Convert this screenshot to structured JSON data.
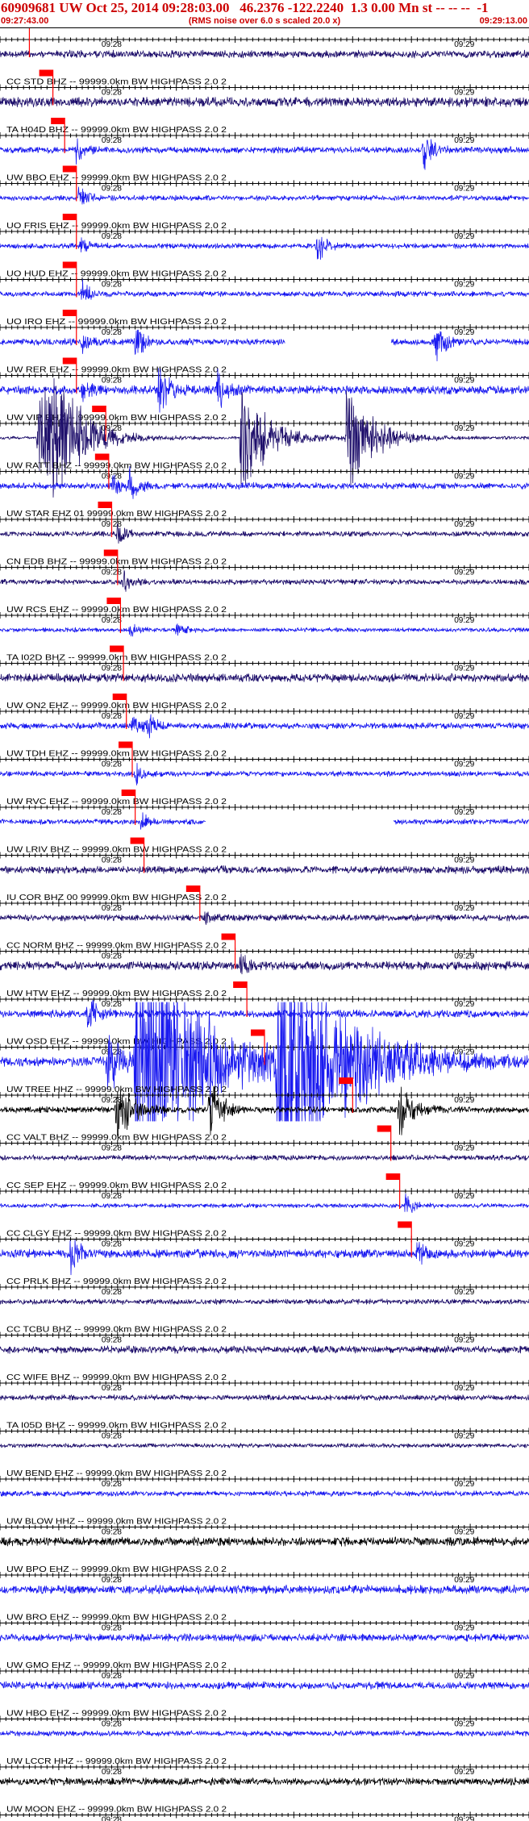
{
  "header": {
    "title": "60909681 UW Oct 25, 2014 09:28:03.00   46.2376 -122.2240  1.3 0.00 Mn st -- -- --  -1",
    "start_time": "09:27:43.00",
    "end_time": "09:29:13.00",
    "note": "(RMS noise over 6.0 s scaled 20.0 x)"
  },
  "chart_data": {
    "type": "line",
    "title": "60909681 UW Oct 25, 2014 09:28:03.00   46.2376 -122.2240  1.3 0.00 Mn st -- -- --  -1",
    "xlabel": "",
    "ylabel": "",
    "time_ticks": [
      "09:28",
      "09:29"
    ],
    "time_tick_seconds": [
      17,
      77
    ],
    "window_seconds": [
      0,
      90
    ],
    "grid": false,
    "colors": {
      "blue": "#1a1af0",
      "navy": "#1e0f6b",
      "black": "#000000",
      "pick": "#ff0000",
      "text": "#000000"
    },
    "bursts": {
      "brief": [
        [
          2,
          24.8
        ],
        [
          2,
          24.8
        ],
        [
          2,
          24.8
        ],
        [
          1.8,
          52.5
        ]
      ],
      "big": [
        [
          1.4,
          18.2
        ],
        [
          6,
          23
        ],
        [
          6,
          47.2
        ]
      ],
      "long": [
        [
          1.4,
          19.8
        ],
        [
          1.2,
          35.6
        ],
        [
          1.2,
          67.9
        ]
      ],
      "busy": [
        [
          2.5,
          6.5
        ],
        [
          2.5,
          9
        ],
        [
          2.5,
          41
        ],
        [
          2.5,
          59
        ]
      ]
    },
    "traces": [
      {
        "label": "",
        "color": "navy",
        "noise": 0.14,
        "pick": 5.0,
        "bursts": []
      },
      {
        "label": "CC STD BHZ -- 99999.0km BW  HIGHPASS  2.0  2",
        "color": "navy",
        "noise": 0.18,
        "pick": 9.0,
        "bursts": []
      },
      {
        "label": "TA H04D BHZ -- 99999.0km BW  HIGHPASS  2.0  2",
        "color": "blue",
        "noise": 0.12,
        "pick": 11.0,
        "bursts": [
          [
            0.5,
            13
          ],
          [
            0.8,
            72
          ]
        ]
      },
      {
        "label": "UW BBO EHZ -- 99999.0km BW  HIGHPASS  2.0  2",
        "color": "blue",
        "noise": 0.1,
        "pick": 13.0,
        "bursts": [
          [
            0.6,
            13.5
          ]
        ]
      },
      {
        "label": "UO FRIS EHZ -- 99999.0km BW  HIGHPASS  2.0  2",
        "color": "blue",
        "noise": 0.1,
        "pick": 13.0,
        "bursts": [
          [
            0.4,
            13.5
          ],
          [
            0.7,
            54
          ]
        ]
      },
      {
        "label": "UO HUD EHZ -- 99999.0km BW  HIGHPASS  2.0  2",
        "color": "blue",
        "noise": 0.1,
        "pick": 13.0,
        "bursts": [
          [
            0.5,
            14
          ]
        ]
      },
      {
        "label": "UO IRO EHZ -- 99999.0km BW  HIGHPASS  2.0  2",
        "color": "blue",
        "noise": 0.12,
        "pick": 13.0,
        "bursts": [
          [
            0.5,
            14
          ],
          [
            0.8,
            23
          ],
          [
            0.9,
            74
          ]
        ],
        "gap": [
          48.5,
          66.5
        ]
      },
      {
        "label": "UW RER EHZ -- 99999.0km BW  HIGHPASS  2.0  2",
        "color": "blue",
        "noise": 0.16,
        "pick": 13.0,
        "bursts": [
          [
            0.5,
            14
          ],
          [
            1.0,
            27
          ],
          [
            0.9,
            37
          ]
        ]
      },
      {
        "label": "UW VIP EHZ -- 99999.0km BW  HIGHPASS  2.0  2",
        "color": "navy",
        "noise": 0.06,
        "pick": 18.0,
        "bursts": "busy"
      },
      {
        "label": "UW RATT BHZ -- 99999.0km BW  HIGHPASS  2.0  2",
        "color": "blue",
        "noise": 0.12,
        "pick": 18.5,
        "bursts": [
          [
            0.6,
            19
          ],
          [
            0.7,
            22
          ]
        ]
      },
      {
        "label": "UW STAR EHZ 01 99999.0km BW  HIGHPASS  2.0  2",
        "color": "navy",
        "noise": 0.1,
        "pick": 19.0,
        "bursts": [
          [
            0.4,
            20
          ]
        ]
      },
      {
        "label": "CN EDB BHZ -- 99999.0km BW  HIGHPASS  2.0  2",
        "color": "navy",
        "noise": 0.1,
        "pick": 20.0,
        "bursts": [
          [
            0.4,
            21
          ]
        ]
      },
      {
        "label": "UW RCS EHZ -- 99999.0km BW  HIGHPASS  2.0  2",
        "color": "blue",
        "noise": 0.08,
        "pick": 20.5,
        "bursts": [
          [
            0.35,
            22
          ],
          [
            0.3,
            30
          ]
        ]
      },
      {
        "label": "TA I02D BHZ -- 99999.0km BW  HIGHPASS  2.0  2",
        "color": "navy",
        "noise": 0.16,
        "pick": 21.0,
        "bursts": []
      },
      {
        "label": "UW ON2 EHZ -- 99999.0km BW  HIGHPASS  2.0  2",
        "color": "blue",
        "noise": 0.12,
        "pick": 21.5,
        "bursts": [
          [
            0.7,
            22.5
          ],
          [
            0.6,
            25
          ]
        ]
      },
      {
        "label": "UW TDH EHZ -- 99999.0km BW  HIGHPASS  2.0  2",
        "color": "blue",
        "noise": 0.1,
        "pick": 22.5,
        "bursts": [
          [
            0.4,
            23
          ]
        ]
      },
      {
        "label": "UW RVC EHZ -- 99999.0km BW  HIGHPASS  2.0  2",
        "color": "blue",
        "noise": 0.1,
        "pick": 23.0,
        "bursts": [
          [
            0.3,
            24
          ]
        ],
        "gap": [
          35,
          67
        ]
      },
      {
        "label": "UW LRIV BHZ -- 99999.0km BW  HIGHPASS  2.0  2",
        "color": "navy",
        "noise": 0.14,
        "pick": 24.5,
        "bursts": []
      },
      {
        "label": "IU COR BHZ 00 99999.0km BW  HIGHPASS  2.0  2",
        "color": "navy",
        "noise": 0.12,
        "pick": 34.0,
        "bursts": [
          [
            0.3,
            35
          ]
        ]
      },
      {
        "label": "CC NORM BHZ -- 99999.0km BW  HIGHPASS  2.0  2",
        "color": "navy",
        "noise": 0.16,
        "pick": 40.0,
        "bursts": [
          [
            0.5,
            41
          ]
        ]
      },
      {
        "label": "UW HTW EHZ -- 99999.0km BW  HIGHPASS  2.0  2",
        "color": "blue",
        "noise": 0.14,
        "pick": 42.0,
        "bursts": [
          [
            0.8,
            15
          ]
        ]
      },
      {
        "label": "UW OSD EHZ -- 99999.0km BW  HIGHPASS  2.0  2",
        "color": "blue",
        "noise": 0.18,
        "pick": 45.0,
        "bursts": "big"
      },
      {
        "label": "UW TREE HHZ -- 99999.0km BW  HIGHPASS  2.0  2",
        "color": "black",
        "noise": 0.12,
        "pick": 60.0,
        "bursts": "long"
      },
      {
        "label": "CC VALT BHZ -- 99999.0km BW  HIGHPASS  2.0  2",
        "color": "navy",
        "noise": 0.1,
        "pick": 66.5,
        "bursts": []
      },
      {
        "label": "CC SEP EHZ -- 99999.0km BW  HIGHPASS  2.0  2",
        "color": "blue",
        "noise": 0.08,
        "pick": 68.0,
        "bursts": [
          [
            0.6,
            69
          ]
        ]
      },
      {
        "label": "CC CLGY EHZ -- 99999.0km BW  HIGHPASS  2.0  2",
        "color": "blue",
        "noise": 0.16,
        "pick": 70.0,
        "bursts": [
          [
            0.8,
            12
          ],
          [
            0.6,
            71
          ]
        ]
      },
      {
        "label": "CC PRLK BHZ -- 99999.0km BW  HIGHPASS  2.0  2",
        "color": "navy",
        "noise": 0.1,
        "pick": null,
        "bursts": []
      },
      {
        "label": "CC TCBU BHZ -- 99999.0km BW  HIGHPASS  2.0  2",
        "color": "navy",
        "noise": 0.14,
        "pick": null,
        "bursts": []
      },
      {
        "label": "CC WIFE BHZ -- 99999.0km BW  HIGHPASS  2.0  2",
        "color": "navy",
        "noise": 0.1,
        "pick": null,
        "bursts": []
      },
      {
        "label": "TA I05D BHZ -- 99999.0km BW  HIGHPASS  2.0  2",
        "color": "navy",
        "noise": 0.08,
        "pick": null,
        "bursts": []
      },
      {
        "label": "UW BEND EHZ -- 99999.0km BW  HIGHPASS  2.0  2",
        "color": "blue",
        "noise": 0.1,
        "pick": null,
        "bursts": []
      },
      {
        "label": "UW BLOW HHZ -- 99999.0km BW  HIGHPASS  2.0  2",
        "color": "black",
        "noise": 0.16,
        "pick": null,
        "bursts": []
      },
      {
        "label": "UW BPO EHZ -- 99999.0km BW  HIGHPASS  2.0  2",
        "color": "blue",
        "noise": 0.16,
        "pick": null,
        "bursts": []
      },
      {
        "label": "UW BRO EHZ -- 99999.0km BW  HIGHPASS  2.0  2",
        "color": "blue",
        "noise": 0.14,
        "pick": null,
        "bursts": []
      },
      {
        "label": "UW GMO EHZ -- 99999.0km BW  HIGHPASS  2.0  2",
        "color": "blue",
        "noise": 0.14,
        "pick": null,
        "bursts": []
      },
      {
        "label": "UW HBO EHZ -- 99999.0km BW  HIGHPASS  2.0  2",
        "color": "blue",
        "noise": 0.1,
        "pick": null,
        "bursts": []
      },
      {
        "label": "UW LCCR HHZ -- 99999.0km BW  HIGHPASS  2.0  2",
        "color": "black",
        "noise": 0.14,
        "pick": null,
        "bursts": []
      },
      {
        "label": "UW MOON EHZ -- 99999.0km BW  HIGHPASS  2.0  2",
        "color": "blue",
        "noise": 0.14,
        "pick": null,
        "bursts": []
      }
    ]
  }
}
